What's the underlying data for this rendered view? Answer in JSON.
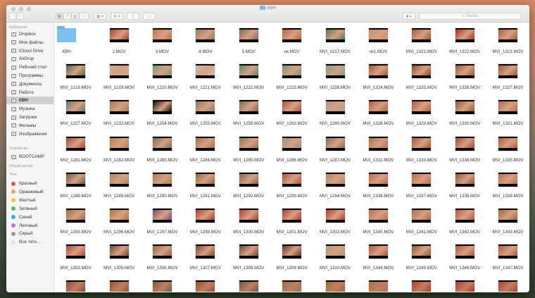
{
  "window": {
    "title": "КВН"
  },
  "toolbar": {
    "back": "‹",
    "forward": "›",
    "search_placeholder": "Поиск",
    "search_icon": "magnifier",
    "gear": "⚙ ▾",
    "arrange": "▦ ▾",
    "dropbox": "⧫ ▾"
  },
  "sidebar": {
    "favorites_header": "Избранное",
    "favorites": [
      {
        "label": "Dropbox"
      },
      {
        "label": "Мои файлы"
      },
      {
        "label": "iCloud Drive"
      },
      {
        "label": "AirDrop"
      },
      {
        "label": "Рабочий стол"
      },
      {
        "label": "Программы"
      },
      {
        "label": "Документы"
      },
      {
        "label": "Работа"
      },
      {
        "label": "КВН",
        "selected": true
      },
      {
        "label": "Музыка"
      },
      {
        "label": "Загрузки"
      },
      {
        "label": "Фильмы"
      },
      {
        "label": "Изображения"
      }
    ],
    "devices_header": "Устройства",
    "devices": [
      {
        "label": "BOOTCAMP"
      }
    ],
    "shared_header": "Общий доступ",
    "tags_header": "Теги",
    "tags": [
      {
        "label": "Красный",
        "color": "#f0504a"
      },
      {
        "label": "Оранжевый",
        "color": "#f5a03a"
      },
      {
        "label": "Желтый",
        "color": "#f5c842"
      },
      {
        "label": "Зеленый",
        "color": "#4cc14c"
      },
      {
        "label": "Синий",
        "color": "#3aa5f0"
      },
      {
        "label": "Лиловый",
        "color": "#c070d8"
      },
      {
        "label": "Серый",
        "color": "#9a9a9a"
      },
      {
        "label": "Все теги…",
        "color": "#e4e4e4"
      }
    ]
  },
  "files": [
    {
      "name": "КВН",
      "type": "folder"
    },
    {
      "name": "2.MOV",
      "c": "#a8402e"
    },
    {
      "name": "3.MOV",
      "c": "#c07850"
    },
    {
      "name": "4.MOV",
      "c": "#8c7a6a"
    },
    {
      "name": "5.MOV",
      "c": "#7a6e64"
    },
    {
      "name": "ок.MOV",
      "c": "#c0604a"
    },
    {
      "name": "MVI_1217.MOV",
      "c": "#4a7a5a"
    },
    {
      "name": "ок1.MOV",
      "c": "#c89070"
    },
    {
      "name": "MVI_1321.MOV",
      "c": "#9a5a3a"
    },
    {
      "name": "MVI_1322.MOV",
      "c": "#b02a24"
    },
    {
      "name": "MVI_1323.MOV",
      "c": "#a85a40"
    },
    {
      "name": "MVI_1218.MOV",
      "c": "#4e6a58"
    },
    {
      "name": "MVI_1219.MOV",
      "c": "#c8b090"
    },
    {
      "name": "MVI_1220.MOV",
      "c": "#6a9a7a"
    },
    {
      "name": "MVI_1221.MOV",
      "c": "#c8c0b0"
    },
    {
      "name": "MVI_1222.MOV",
      "c": "#5e8a6a"
    },
    {
      "name": "MVI_1223.MOV",
      "c": "#6a9a7a"
    },
    {
      "name": "MVI_1226.MOV",
      "c": "#7aa08a"
    },
    {
      "name": "MVI_1324.MOV",
      "c": "#9a5a3a"
    },
    {
      "name": "MVI_1325.MOV",
      "c": "#8a4a34"
    },
    {
      "name": "MVI_1326.MOV",
      "c": "#9a5a3a"
    },
    {
      "name": "MVI_1327.MOV",
      "c": "#9a5a3a"
    },
    {
      "name": "MVI_1227.MOV",
      "c": "#5a8070"
    },
    {
      "name": "MVI_1232.MOV",
      "c": "#a07a5a"
    },
    {
      "name": "MVI_1254.MOV",
      "c": "#0a0a0a"
    },
    {
      "name": "MVI_1255.MOV",
      "c": "#8a7a6a"
    },
    {
      "name": "MVI_1258.MOV",
      "c": "#7a6a5a"
    },
    {
      "name": "MVI_1263.MOV",
      "c": "#b05040"
    },
    {
      "name": "MVI_1280.MOV",
      "c": "#a0a090"
    },
    {
      "name": "MVI_1328.MOV",
      "c": "#b05a44"
    },
    {
      "name": "MVI_1329.MOV",
      "c": "#b05a44"
    },
    {
      "name": "MVI_1330.MOV",
      "c": "#8a5a3a"
    },
    {
      "name": "MVI_1331.MOV",
      "c": "#b06a50"
    },
    {
      "name": "MVI_1281.MOV",
      "c": "#a04a34"
    },
    {
      "name": "MVI_1282.MOV",
      "c": "#b08050"
    },
    {
      "name": "MVI_1283.MOV",
      "c": "#7a6a5a"
    },
    {
      "name": "MVI_1284.MOV",
      "c": "#a07050"
    },
    {
      "name": "MVI_1285.MOV",
      "c": "#8a7a60"
    },
    {
      "name": "MVI_1286.MOV",
      "c": "#a09080"
    },
    {
      "name": "MVI_1287.MOV",
      "c": "#7a7060"
    },
    {
      "name": "MVI_1332.MOV",
      "c": "#b07050"
    },
    {
      "name": "MVI_1333.MOV",
      "c": "#a05a3a"
    },
    {
      "name": "MVI_1334.MOV",
      "c": "#a04a3a"
    },
    {
      "name": "MVI_1335.MOV",
      "c": "#b05a40"
    },
    {
      "name": "MVI_1288.MOV",
      "c": "#6a5a4a"
    },
    {
      "name": "MVI_1289.MOV",
      "c": "#a08a6a"
    },
    {
      "name": "MVI_1290.MOV",
      "c": "#a08050"
    },
    {
      "name": "MVI_1291.MOV",
      "c": "#8a6a4a"
    },
    {
      "name": "MVI_1292.MOV",
      "c": "#7a6a5a"
    },
    {
      "name": "MVI_1293.MOV",
      "c": "#b05040"
    },
    {
      "name": "MVI_1294.MOV",
      "c": "#b08a6a"
    },
    {
      "name": "MVI_1336.MOV",
      "c": "#c06a50"
    },
    {
      "name": "MVI_1337.MOV",
      "c": "#c06a50"
    },
    {
      "name": "MVI_1338.MOV",
      "c": "#8a5a3a"
    },
    {
      "name": "MVI_1339.MOV",
      "c": "#c06a50"
    },
    {
      "name": "MVI_1295.MOV",
      "c": "#9a6a50"
    },
    {
      "name": "MVI_1296.MOV",
      "c": "#b07a40"
    },
    {
      "name": "MVI_1297.MOV",
      "c": "#7a4a8a"
    },
    {
      "name": "MVI_1298.MOV",
      "c": "#b03a34"
    },
    {
      "name": "MVI_1300.MOV",
      "c": "#b03a34"
    },
    {
      "name": "MVI_1301.MOV",
      "c": "#b03a34"
    },
    {
      "name": "MVI_1302.MOV",
      "c": "#b03a34"
    },
    {
      "name": "MVI_1340.MOV",
      "c": "#c06a50"
    },
    {
      "name": "MVI_1341.MOV",
      "c": "#b06a50"
    },
    {
      "name": "MVI_1342.MOV",
      "c": "#b05a44"
    },
    {
      "name": "MVI_1343.MOV",
      "c": "#9a6a40"
    },
    {
      "name": "MVI_1303.MOV",
      "c": "#b04a40"
    },
    {
      "name": "MVI_1305.MOV",
      "c": "#6a4a3a"
    },
    {
      "name": "MVI_1306.MOV",
      "c": "#8a6a4a"
    },
    {
      "name": "MVI_1307.MOV",
      "c": "#7a4a2a"
    },
    {
      "name": "MVI_1308.MOV",
      "c": "#6a4a3a"
    },
    {
      "name": "MVI_1309.MOV",
      "c": "#5a3a2a"
    },
    {
      "name": "MVI_1310.MOV",
      "c": "#b09a80"
    },
    {
      "name": "MVI_1344.MOV",
      "c": "#b05a44"
    },
    {
      "name": "MVI_1345.MOV",
      "c": "#8a5a3a"
    },
    {
      "name": "MVI_1346.MOV",
      "c": "#b05a44"
    },
    {
      "name": "MVI_1347.MOV",
      "c": "#b05a44"
    }
  ],
  "partial_row": [
    "#8a4a3a",
    "#a04a34",
    "#7a5a4a",
    "#9a4a3a",
    "#6a5a4a",
    "#9a7050",
    "#9a6a40",
    "#b07050",
    "#b03a34",
    "#b03a34",
    "#a84034"
  ]
}
